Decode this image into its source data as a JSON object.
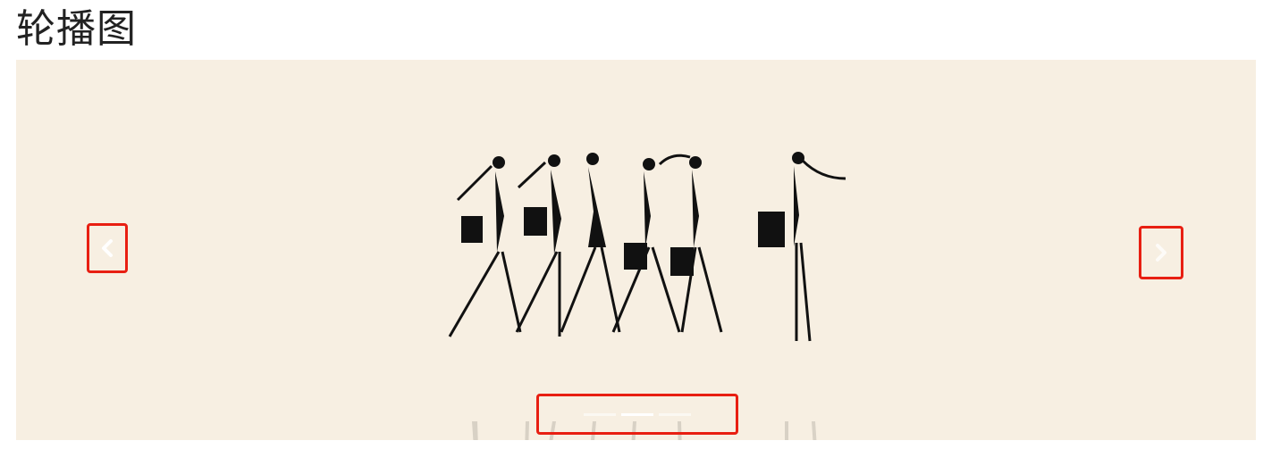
{
  "page": {
    "title": "轮播图"
  },
  "carousel": {
    "background_color": "#f7efe2",
    "slide_image": "fashion-women-silhouettes-illustration",
    "prev_icon": "chevron-left-icon",
    "next_icon": "chevron-right-icon",
    "highlight_color": "#e81f12",
    "indicators": [
      {
        "active": false
      },
      {
        "active": true
      },
      {
        "active": false
      }
    ]
  }
}
